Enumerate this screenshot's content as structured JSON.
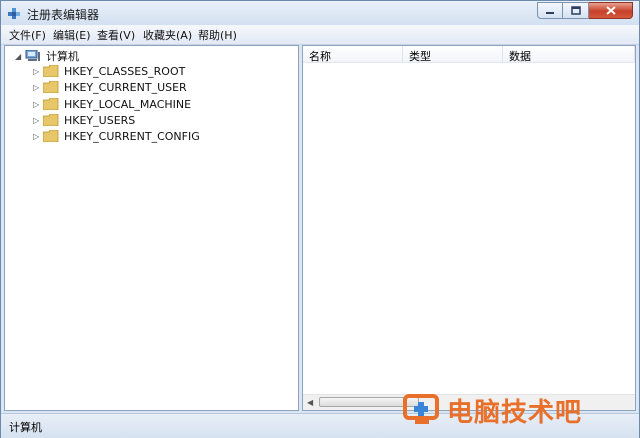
{
  "window": {
    "title": "注册表编辑器"
  },
  "menu": [
    {
      "label": "文件(F)"
    },
    {
      "label": "编辑(E)"
    },
    {
      "label": "查看(V)"
    },
    {
      "label": "收藏夹(A)"
    },
    {
      "label": "帮助(H)"
    }
  ],
  "tree": {
    "root": {
      "label": "计算机",
      "expander": "◢"
    },
    "children": [
      {
        "label": "HKEY_CLASSES_ROOT",
        "expander": "▷"
      },
      {
        "label": "HKEY_CURRENT_USER",
        "expander": "▷"
      },
      {
        "label": "HKEY_LOCAL_MACHINE",
        "expander": "▷"
      },
      {
        "label": "HKEY_USERS",
        "expander": "▷"
      },
      {
        "label": "HKEY_CURRENT_CONFIG",
        "expander": "▷"
      }
    ]
  },
  "list": {
    "columns": [
      {
        "label": "名称"
      },
      {
        "label": "类型"
      },
      {
        "label": "数据"
      }
    ]
  },
  "status": {
    "path": "计算机"
  },
  "watermark": {
    "text": "电脑技术吧"
  },
  "icons": {
    "app": "registry-editor-icon",
    "folder": "folder-icon",
    "computer": "computer-icon",
    "minimize": "minimize-icon",
    "maximize": "maximize-icon",
    "close": "close-icon"
  },
  "colors": {
    "close_button": "#c7402a",
    "folder": "#e8c76a",
    "watermark": "#e8702a"
  }
}
